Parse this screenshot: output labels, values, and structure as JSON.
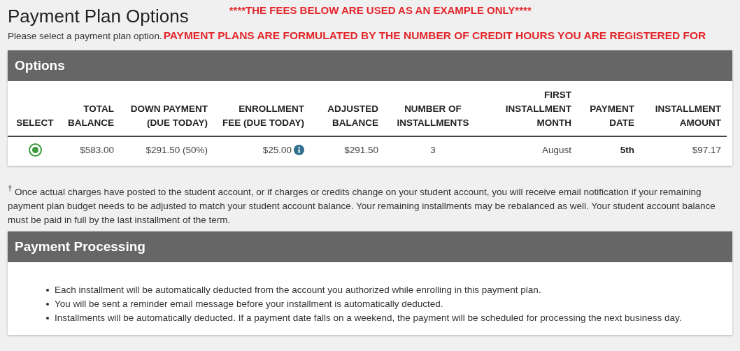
{
  "page_title": "Payment Plan Options",
  "example_notice": "****THE FEES BELOW ARE USED AS AN EXAMPLE ONLY****",
  "instruction": "Please select a payment plan option.",
  "credit_notice": "PAYMENT PLANS ARE FORMULATED BY THE NUMBER OF CREDIT HOURS YOU ARE REGISTERED FOR",
  "options_panel": {
    "title": "Options",
    "columns": [
      "SELECT",
      "TOTAL\nBALANCE",
      "DOWN PAYMENT\n(DUE TODAY)",
      "ENROLLMENT\nFEE (DUE TODAY)",
      "ADJUSTED\nBALANCE",
      "NUMBER OF\nINSTALLMENTS",
      "FIRST\nINSTALLMENT\nMONTH",
      "PAYMENT\nDATE",
      "INSTALLMENT\nAMOUNT"
    ],
    "rows": [
      {
        "cells": [
          {
            "kind": "radio",
            "selected": true
          },
          {
            "kind": "text",
            "text": "$583.00",
            "bold": false,
            "info": false
          },
          {
            "kind": "text",
            "text": "$291.50 (50%)",
            "bold": false,
            "info": false
          },
          {
            "kind": "text",
            "text": "$25.00",
            "bold": false,
            "info": true
          },
          {
            "kind": "text",
            "text": "$291.50",
            "bold": false,
            "info": false
          },
          {
            "kind": "text",
            "text": "3",
            "bold": false,
            "info": false
          },
          {
            "kind": "text",
            "text": "August",
            "bold": false,
            "info": false
          },
          {
            "kind": "text",
            "text": "5th",
            "bold": true,
            "info": false
          },
          {
            "kind": "text",
            "text": "$97.17",
            "bold": false,
            "info": false
          }
        ]
      }
    ]
  },
  "footnote": "$^{†}$ Once actual charges have posted to the student account, or if charges or credits change on your student account, you will receive email notification if your remaining payment plan budget needs to be adjusted to match your student account balance. Your remaining installments may be rebalanced as well. Your student account balance must be paid in full by the last installment of the term.",
  "processing_panel": {
    "title": "Payment Processing",
    "items": [
      "Each installment will be automatically deducted from the account you authorized while enrolling in this payment plan.",
      "You will be sent a reminder email message before your installment is automatically deducted.",
      "Installments will be automatically deducted. If a payment date falls on a weekend, the payment will be scheduled for processing the next business day."
    ]
  }
}
